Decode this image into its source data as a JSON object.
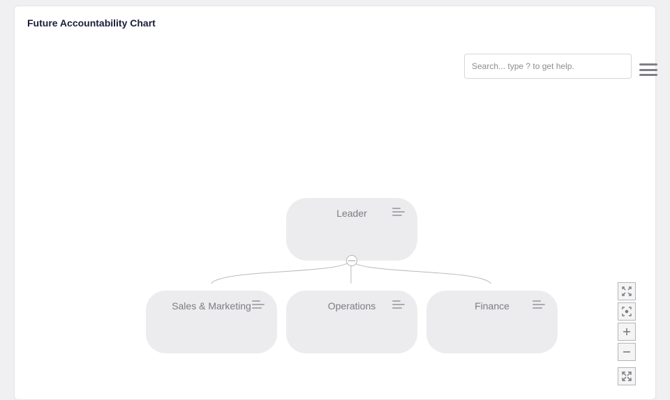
{
  "title": "Future Accountability Chart",
  "search": {
    "placeholder": "Search... type ? to get help."
  },
  "org": {
    "root": {
      "label": "Leader"
    },
    "children": [
      {
        "label": "Sales & Marketing"
      },
      {
        "label": "Operations"
      },
      {
        "label": "Finance"
      }
    ]
  }
}
